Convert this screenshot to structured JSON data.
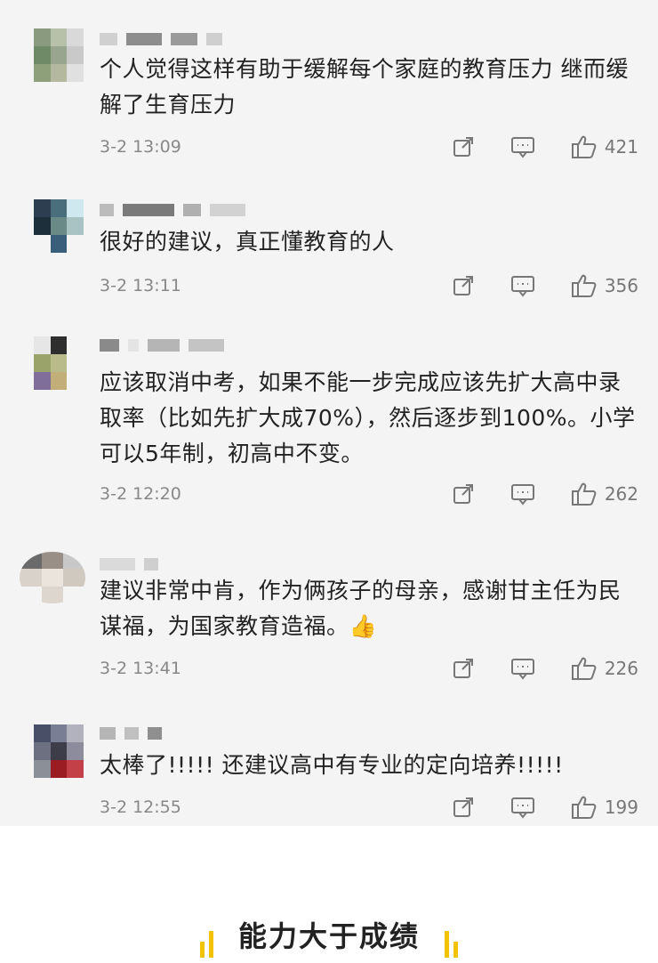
{
  "comments": [
    {
      "text": "个人觉得这样有助于缓解每个家庭的教育压力 继而缓解了生育压力",
      "time": "3-2 13:09",
      "likes": "421"
    },
    {
      "text": "很好的建议，真正懂教育的人",
      "time": "3-2 13:11",
      "likes": "356"
    },
    {
      "text": "应该取消中考，如果不能一步完成应该先扩大高中录取率（比如先扩大成70%），然后逐步到100%。小学可以5年制，初高中不变。",
      "time": "3-2 12:20",
      "likes": "262"
    },
    {
      "text": "建议非常中肯，作为俩孩子的母亲，感谢甘主任为民谋福，为国家教育造福。👍",
      "time": "3-2 13:41",
      "likes": "226"
    },
    {
      "text": "太棒了!!!!! 还建议高中有专业的定向培养!!!!!",
      "time": "3-2 12:55",
      "likes": "199"
    }
  ],
  "icons": {
    "share": "share-icon",
    "reply": "reply-icon",
    "like": "thumbs-up-icon"
  },
  "footer": {
    "title": "能力大于成绩"
  },
  "colors": {
    "panel_bg": "#f4f4f4",
    "meta_gray": "#888888",
    "accent_yellow": "#f2c300"
  }
}
